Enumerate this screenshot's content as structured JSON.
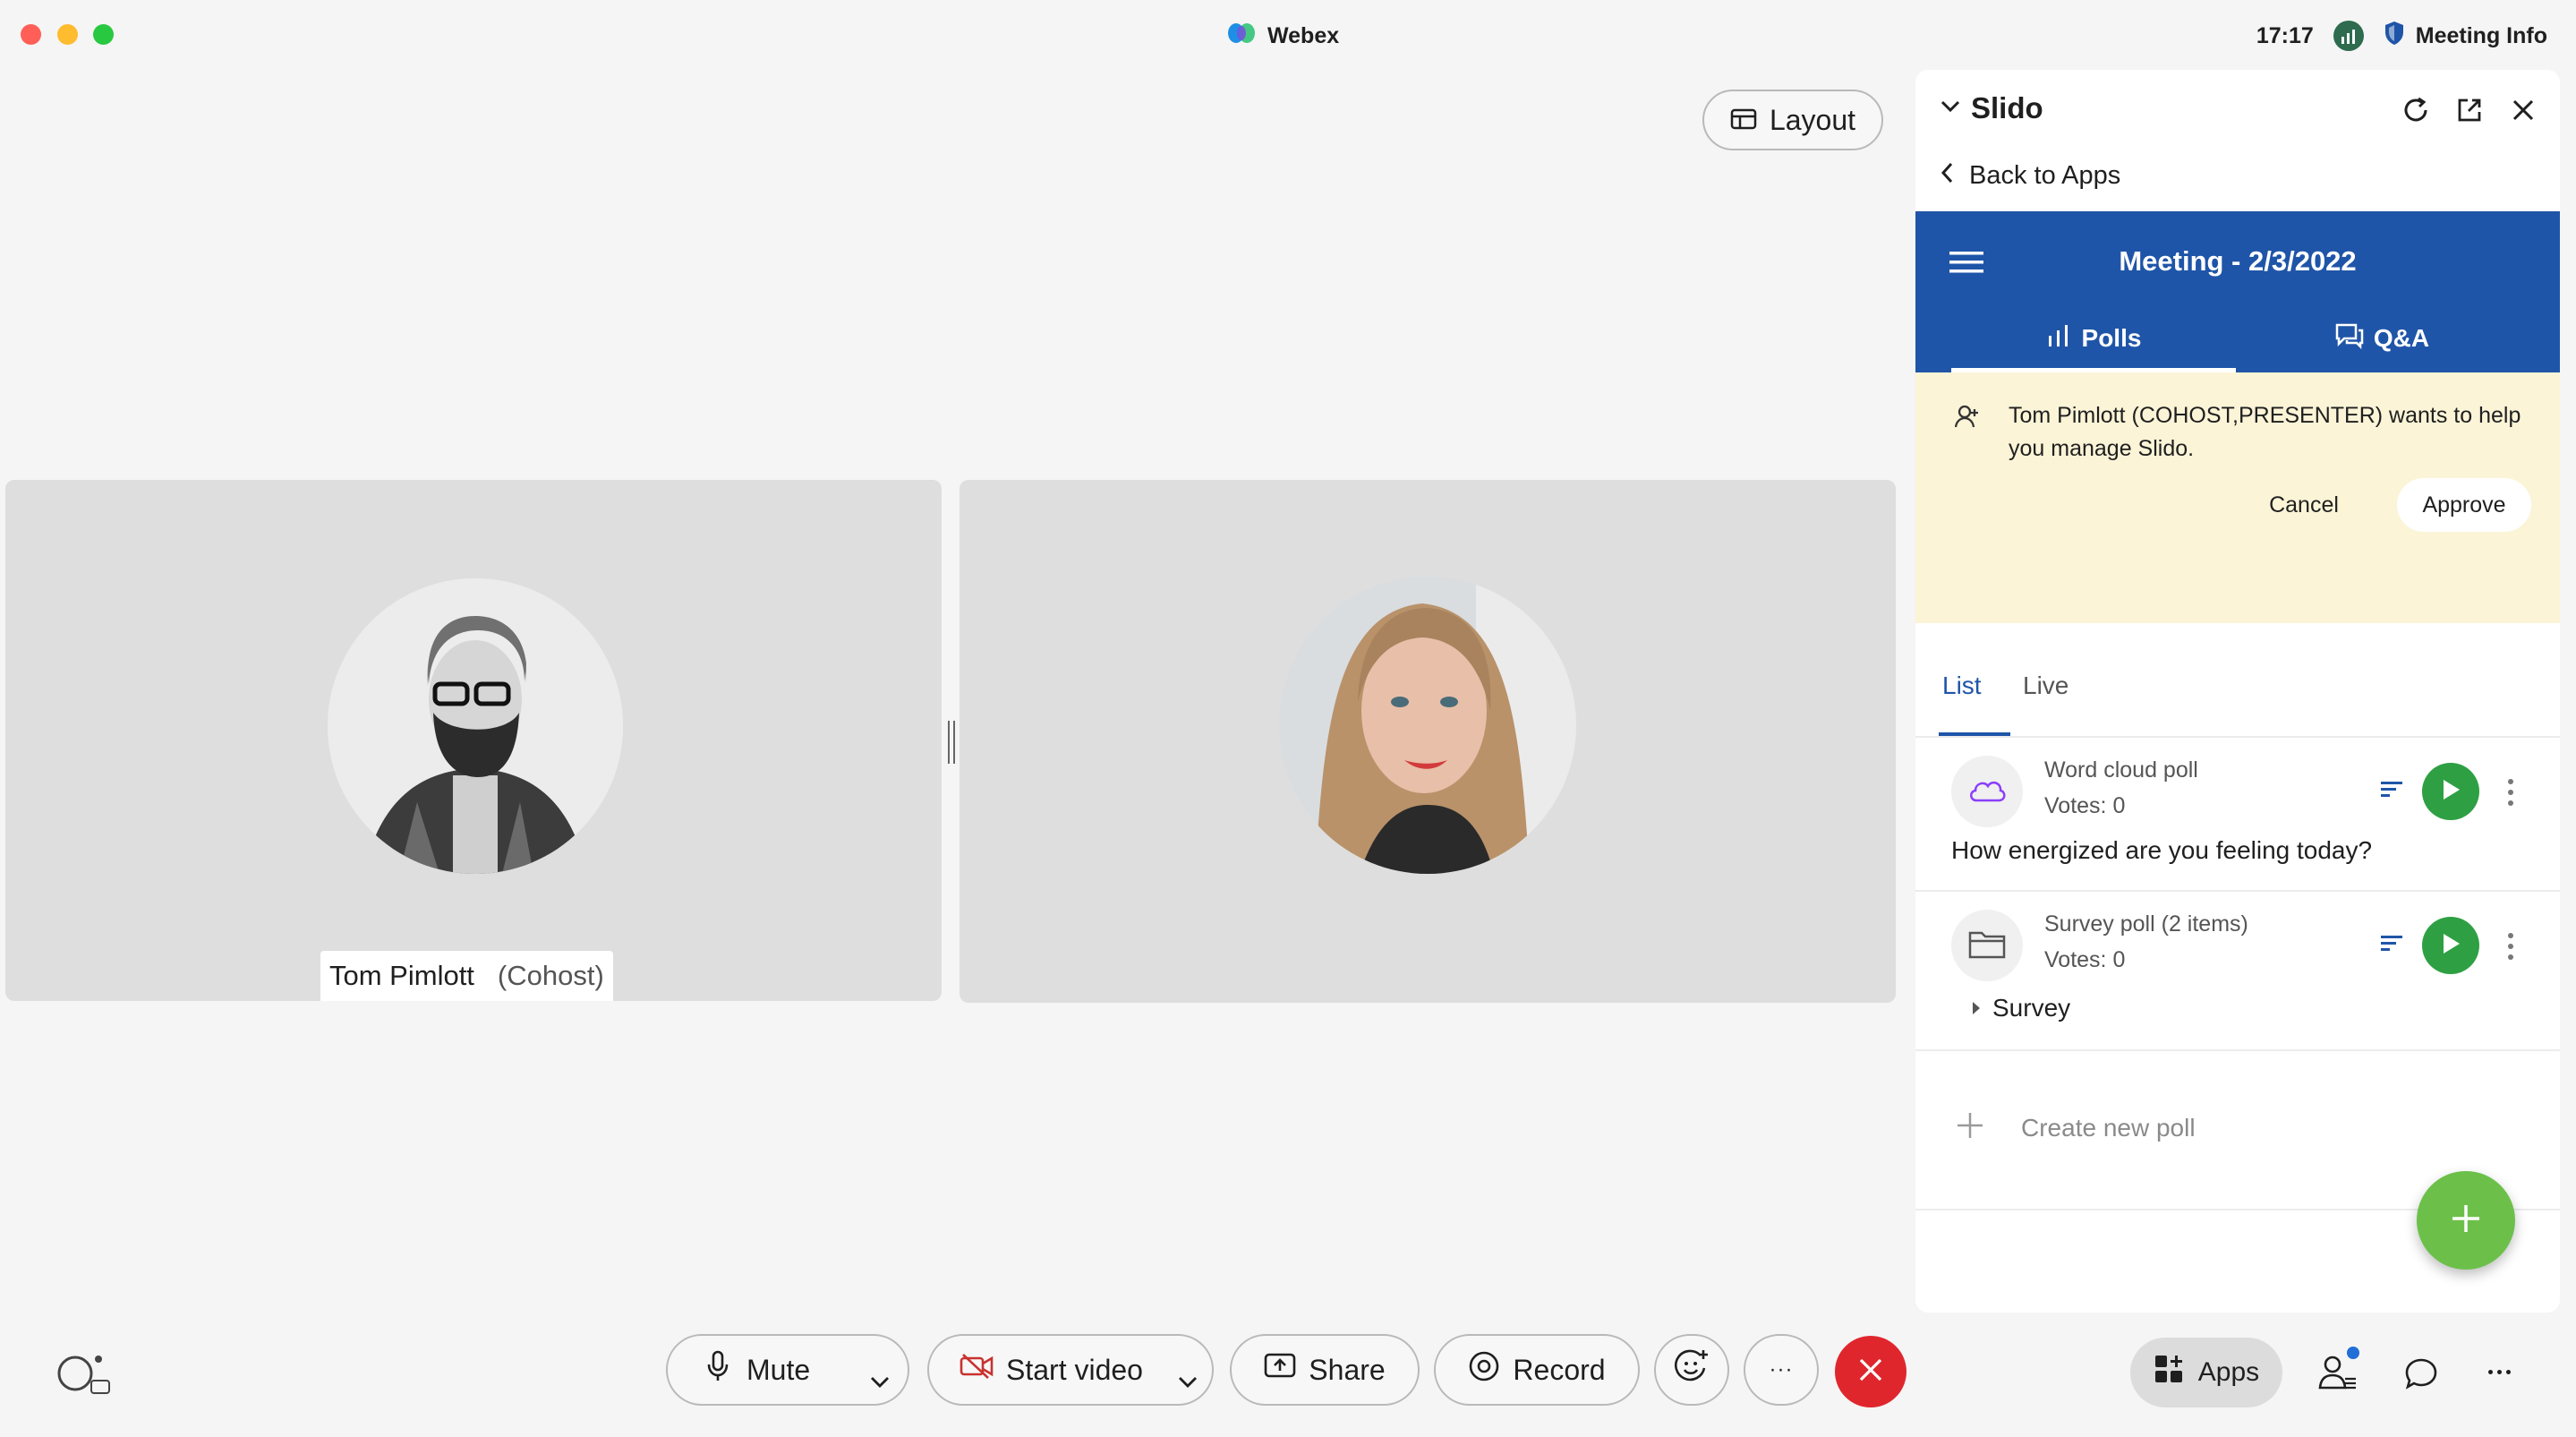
{
  "window": {
    "title": "Webex",
    "clock": "17:17",
    "meeting_info": "Meeting Info",
    "layout_label": "Layout"
  },
  "participants": [
    {
      "name": "Tom Pimlott",
      "role": "(Cohost)"
    }
  ],
  "slido": {
    "title": "Slido",
    "back_label": "Back to Apps",
    "meeting_title": "Meeting - 2/3/2022",
    "tabs": [
      {
        "label": "Polls"
      },
      {
        "label": "Q&A"
      }
    ],
    "notice": {
      "text": "Tom Pimlott (COHOST,PRESENTER) wants to help you manage Slido.",
      "cancel_label": "Cancel",
      "approve_label": "Approve"
    },
    "sub_tabs": [
      {
        "label": "List"
      },
      {
        "label": "Live"
      }
    ],
    "polls": [
      {
        "type": "Word cloud poll",
        "votes": "Votes: 0",
        "question": "How energized are you feeling today?",
        "icon": "cloud-icon"
      },
      {
        "type": "Survey poll (2 items)",
        "votes": "Votes: 0",
        "question": "Survey",
        "icon": "folder-icon"
      }
    ],
    "create_label": "Create new poll",
    "accent_color": "#1f55a8",
    "play_color": "#2ea043",
    "fab_color": "#6cc04a"
  },
  "toolbar": {
    "mute_label": "Mute",
    "start_video_label": "Start video",
    "share_label": "Share",
    "record_label": "Record",
    "more_label": "···",
    "apps_label": "Apps",
    "end_color": "#e0262d"
  }
}
